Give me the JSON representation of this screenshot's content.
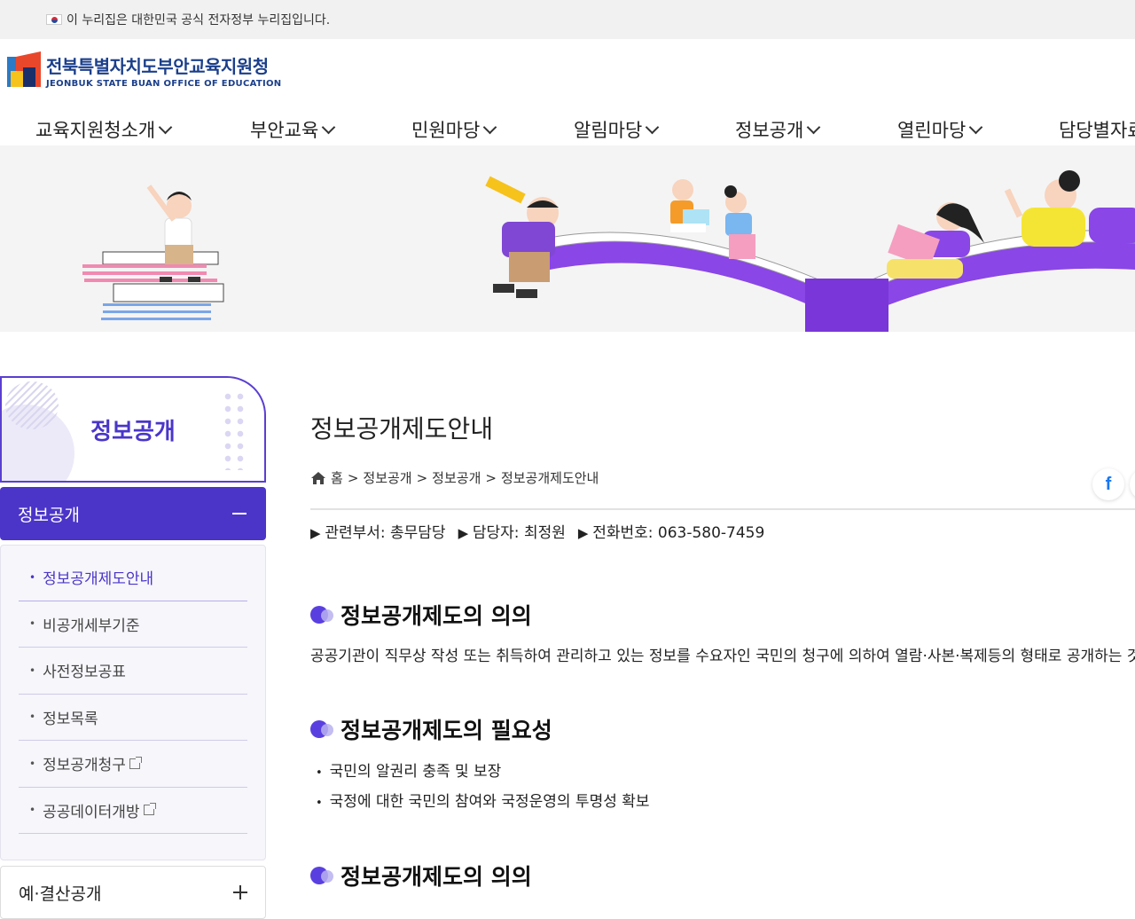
{
  "gov_bar": {
    "text": "이 누리집은 대한민국 공식 전자정부 누리집입니다."
  },
  "logo": {
    "name_ko": "전북특별자치도부안교육지원청",
    "name_en": "JEONBUK STATE BUAN OFFICE OF EDUCATION"
  },
  "gnb": [
    {
      "label": "교육지원청소개"
    },
    {
      "label": "부안교육"
    },
    {
      "label": "민원마당"
    },
    {
      "label": "알림마당"
    },
    {
      "label": "정보공개"
    },
    {
      "label": "열린마당"
    },
    {
      "label": "담당별자료"
    }
  ],
  "sidebar": {
    "title": "정보공개",
    "active_menu": "정보공개",
    "items": [
      {
        "label": "정보공개제도안내",
        "active": true
      },
      {
        "label": "비공개세부기준"
      },
      {
        "label": "사전정보공표"
      },
      {
        "label": "정보목록"
      },
      {
        "label": "정보공개청구",
        "external": true
      },
      {
        "label": "공공데이터개방",
        "external": true
      }
    ],
    "next_menu": "예·결산공개"
  },
  "content": {
    "title": "정보공개제도안내",
    "breadcrumb": [
      "홈",
      "정보공개",
      "정보공개",
      "정보공개제도안내"
    ],
    "share_icon": "f",
    "info": {
      "dept": "관련부서: 총무담당",
      "person": "담당자: 최정원",
      "phone": "전화번호: 063-580-7459"
    },
    "sections": [
      {
        "heading": "정보공개제도의 의의",
        "text": "공공기관이 직무상 작성 또는 취득하여 관리하고 있는 정보를 수요자인 국민의 청구에 의하여 열람·사본·복제등의 형태로 공개하는 것"
      },
      {
        "heading": "정보공개제도의 필요성",
        "items": [
          "국민의 알권리 충족 및 보장",
          "국정에 대한 국민의 참여와 국정운영의 투명성 확보"
        ]
      },
      {
        "heading": "정보공개제도의 의의"
      }
    ]
  },
  "colors": {
    "accent": "#4b35c8",
    "brand": "#1b3f8b"
  }
}
